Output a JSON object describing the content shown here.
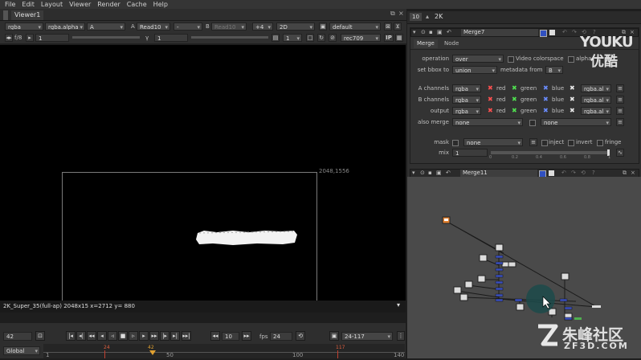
{
  "menu": [
    "File",
    "Edit",
    "Layout",
    "Viewer",
    "Render",
    "Cache",
    "Help"
  ],
  "viewer_tab": "Viewer1",
  "viewer_toolbar": {
    "channels": "rgba",
    "alpha_channel": "rgba.alpha",
    "a_input": "A",
    "a_label": "A",
    "a_node": "Read10",
    "wipe": "-",
    "b_label": "B",
    "b_node": "Read10",
    "zoom": "+4",
    "view_mode": "2D",
    "lut": "default",
    "fstop_label": "f/8",
    "gain_value": "1",
    "gamma_label": "γ",
    "gamma_value": "1",
    "proxy_value": "1",
    "display_lut": "rec709",
    "ip_label": "IP"
  },
  "viewer": {
    "format_corner": "2048,1556",
    "info_bar": "2K_Super_35(full-ap) 2048x15  x=2712 y= 880"
  },
  "timeline": {
    "current_frame": "42",
    "step": "10",
    "fps_label": "fps",
    "fps": "24",
    "range": "24-117",
    "scope": "Global",
    "ruler_ticks": [
      "1",
      "50",
      "100",
      "140"
    ],
    "markers": [
      "24",
      "42",
      "117"
    ]
  },
  "right_panel": {
    "tab_number": "10",
    "tab_label": "2K"
  },
  "properties": {
    "node_name": "Merge7",
    "tabs": [
      "Merge",
      "Node"
    ],
    "operation_label": "operation",
    "operation": "over",
    "video_colorspace_label": "Video colorspace",
    "alpha_masking_label": "alpha",
    "set_bbox_label": "set bbox to",
    "set_bbox": "union",
    "metadata_label": "metadata from",
    "metadata": "B",
    "a_channels_label": "A channels",
    "b_channels_label": "B channels",
    "output_label": "output",
    "channel_value": "rgba",
    "extra_channel": "rgba.al",
    "red": "red",
    "green": "green",
    "blue": "blue",
    "also_merge_label": "also merge",
    "also_merge": "none",
    "also_merge_2": "none",
    "mask_label": "mask",
    "mask": "none",
    "inject_label": "inject",
    "invert_label": "invert",
    "fringe_label": "fringe",
    "mix_label": "mix",
    "mix": "1",
    "slider_ticks": [
      "0",
      "0.2",
      "0.4",
      "0.6",
      "0.8",
      "1"
    ]
  },
  "second_node_name": "Merge11",
  "watermarks": {
    "youku_brand": "YOUKU",
    "youku_cn": "优酷",
    "zf_cn": "朱峰社区",
    "zf_en": "ZF3D.COM"
  }
}
